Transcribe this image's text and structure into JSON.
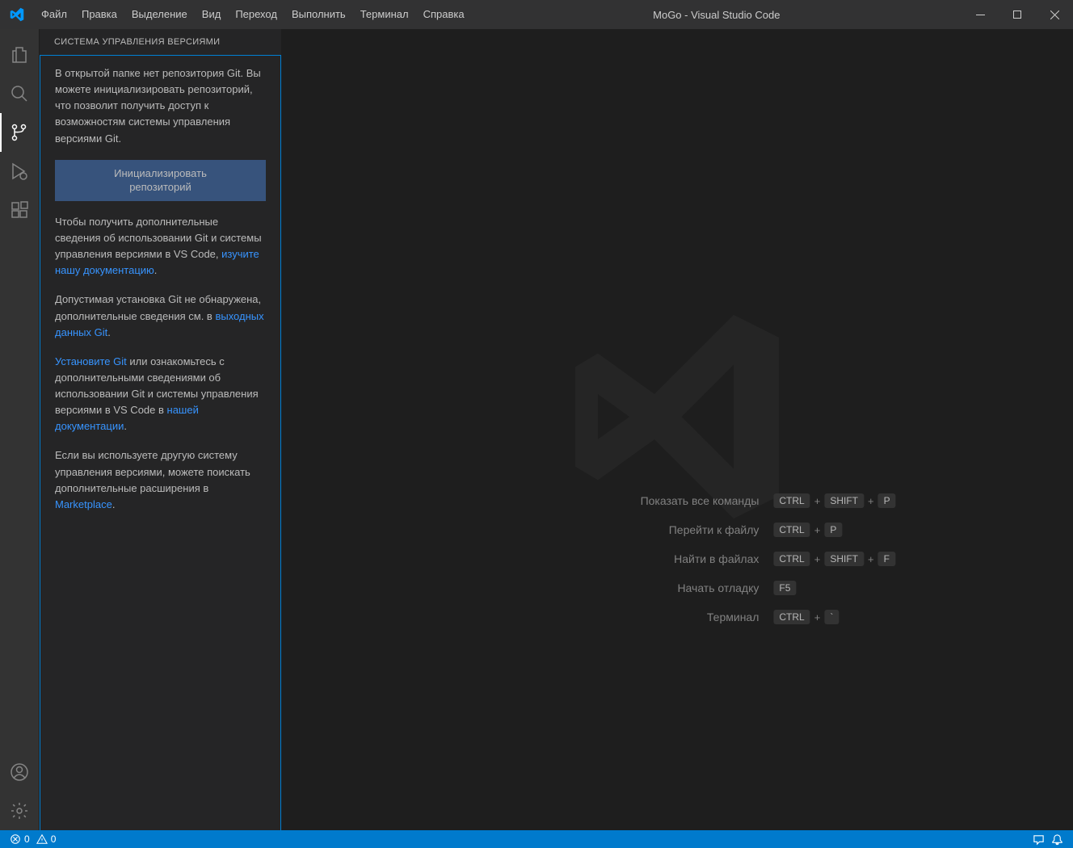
{
  "titlebar": {
    "menu": [
      "Файл",
      "Правка",
      "Выделение",
      "Вид",
      "Переход",
      "Выполнить",
      "Терминал",
      "Справка"
    ],
    "title": "MoGo - Visual Studio Code"
  },
  "sidebar": {
    "header": "Система управления версиями",
    "p1": "В открытой папке нет репозитория Git. Вы можете инициализировать репозиторий, что позволит получить доступ к возможностям системы управления версиями Git.",
    "init_button_line1": "Инициализировать",
    "init_button_line2": "репозиторий",
    "p2_a": "Чтобы получить дополнительные сведения об использовании Git и системы управления версиями в VS Code, ",
    "p2_link": "изучите нашу документацию",
    "p2_b": ".",
    "p3_a": "Допустимая установка Git не обнаружена, дополнительные сведения см. в ",
    "p3_link": "выходных данных Git",
    "p3_b": ".",
    "p4_link1": "Установите Git",
    "p4_a": " или ознакомьтесь с дополнительными сведениями об использовании Git и системы управления версиями в VS Code в ",
    "p4_link2": "нашей документации",
    "p4_b": ".",
    "p5_a": "Если вы используете другую систему управления версиями, можете поискать дополнительные расширения в ",
    "p5_link": "Marketplace",
    "p5_b": "."
  },
  "shortcuts": [
    {
      "label": "Показать все команды",
      "keys": [
        "CTRL",
        "SHIFT",
        "P"
      ]
    },
    {
      "label": "Перейти к файлу",
      "keys": [
        "CTRL",
        "P"
      ]
    },
    {
      "label": "Найти в файлах",
      "keys": [
        "CTRL",
        "SHIFT",
        "F"
      ]
    },
    {
      "label": "Начать отладку",
      "keys": [
        "F5"
      ]
    },
    {
      "label": "Терминал",
      "keys": [
        "CTRL",
        "`"
      ]
    }
  ],
  "statusbar": {
    "errors": "0",
    "warnings": "0"
  }
}
